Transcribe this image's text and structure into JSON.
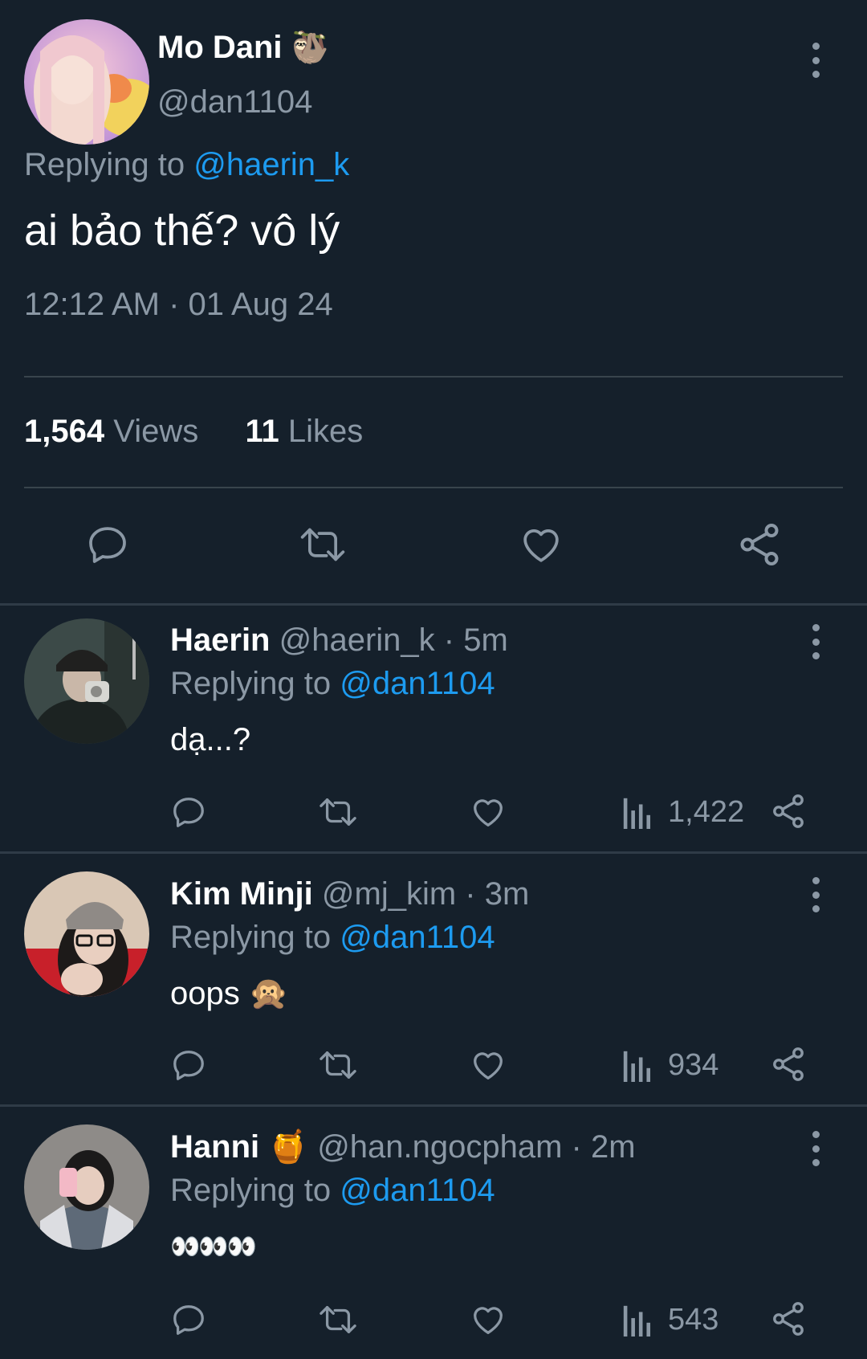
{
  "main_tweet": {
    "author_name": "Mo Dani",
    "author_emoji": "🦥",
    "handle": "@dan1104",
    "replying_prefix": "Replying to",
    "replying_handle": "@haerin_k",
    "text": "ai bảo thế? vô lý",
    "timestamp": "12:12 AM · 01 Aug 24",
    "views_count": "1,564",
    "views_label": "Views",
    "likes_count": "11",
    "likes_label": "Likes"
  },
  "replies": [
    {
      "name": "Haerin",
      "handle_time": "@haerin_k · 5m",
      "replying_prefix": "Replying to",
      "replying_handle": "@dan1104",
      "text": "dạ...?",
      "views": "1,422"
    },
    {
      "name": "Kim Minji",
      "handle_time": "@mj_kim · 3m",
      "replying_prefix": "Replying to",
      "replying_handle": "@dan1104",
      "text": "oops",
      "text_emoji": "🙊",
      "views": "934"
    },
    {
      "name": "Hanni",
      "name_emoji": "🍯",
      "handle_time": "@han.ngocpham · 2m",
      "replying_prefix": "Replying to",
      "replying_handle": "@dan1104",
      "text": "👀👀👀",
      "views": "543"
    }
  ],
  "icons": [
    "reply-icon",
    "retweet-icon",
    "like-icon",
    "share-icon",
    "views-icon",
    "more-icon"
  ],
  "colors": {
    "background": "#15202b",
    "accent": "#1d9bf0",
    "secondary_text": "#8b98a5",
    "divider": "#38444d"
  }
}
